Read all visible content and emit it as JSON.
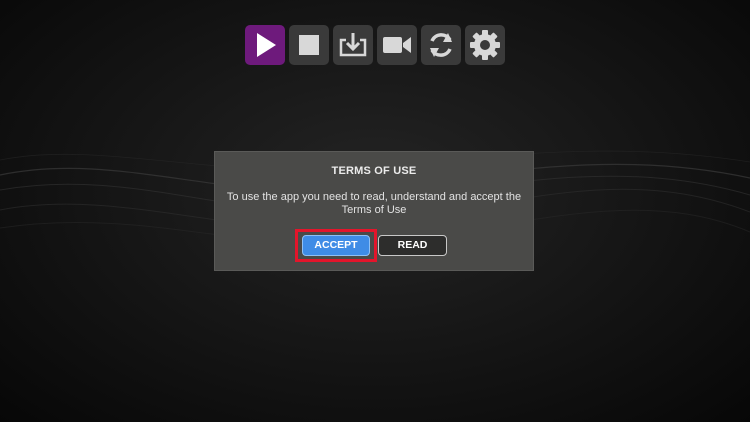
{
  "toolbar": {
    "buttons": [
      {
        "icon": "play-icon",
        "active": true
      },
      {
        "icon": "stop-icon",
        "active": false
      },
      {
        "icon": "download-icon",
        "active": false
      },
      {
        "icon": "video-camera-icon",
        "active": false
      },
      {
        "icon": "refresh-icon",
        "active": false
      },
      {
        "icon": "gear-icon",
        "active": false
      }
    ]
  },
  "dialog": {
    "title": "TERMS OF USE",
    "message_line1": "To use the app you need to read, understand and accept the",
    "message_line2": "Terms of Use",
    "accept_label": "ACCEPT",
    "read_label": "READ"
  },
  "colors": {
    "active_toolbar": "#6e1a7c",
    "toolbar_button": "#3a3a3a",
    "dialog_background": "#4a4a48",
    "accept_button": "#3f8ce6",
    "highlight": "#e3152b"
  }
}
